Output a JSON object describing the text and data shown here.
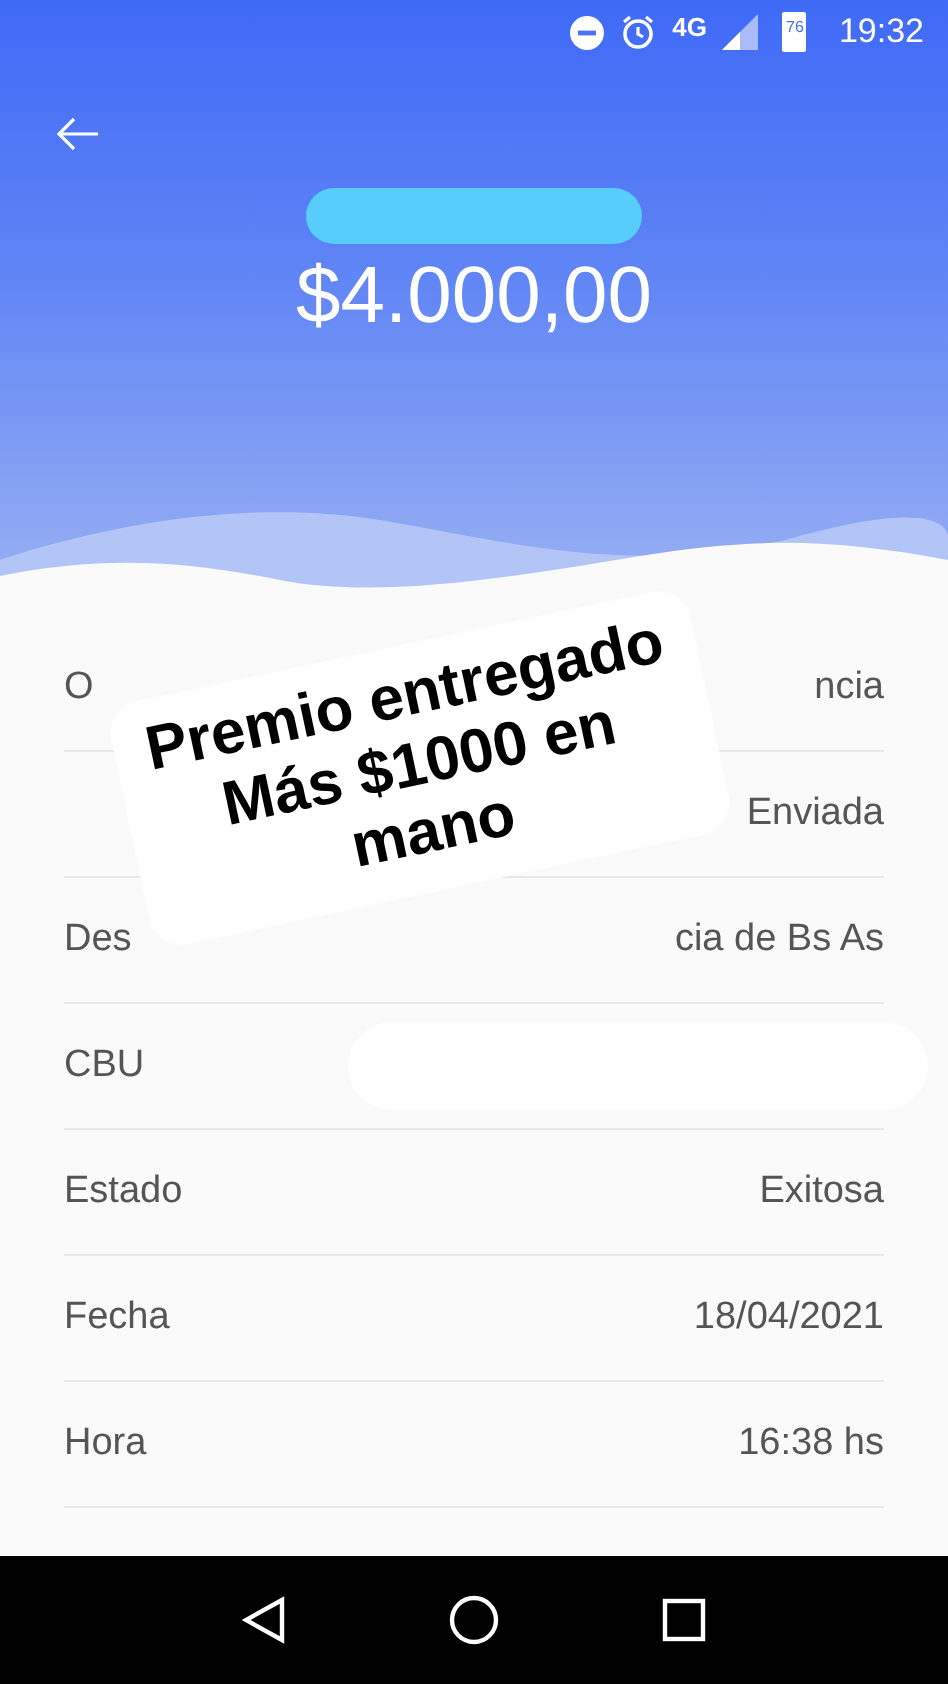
{
  "status_bar": {
    "network": "4G",
    "battery": "76",
    "time": "19:32"
  },
  "header": {
    "amount": "$4.000,00"
  },
  "rows": [
    {
      "label": "O",
      "value": "ncia",
      "kind": "text"
    },
    {
      "label": "",
      "value": "Enviada",
      "kind": "text"
    },
    {
      "label": "Des",
      "value": "cia de Bs As",
      "kind": "text"
    },
    {
      "label": "CBU",
      "value": "",
      "kind": "redacted"
    },
    {
      "label": "Estado",
      "value": "Exitosa",
      "kind": "text"
    },
    {
      "label": "Fecha",
      "value": "18/04/2021",
      "kind": "text"
    },
    {
      "label": "Hora",
      "value": "16:38 hs",
      "kind": "text"
    }
  ],
  "sticker": {
    "text": "Premio entregado\nMás $1000 en\nmano"
  }
}
